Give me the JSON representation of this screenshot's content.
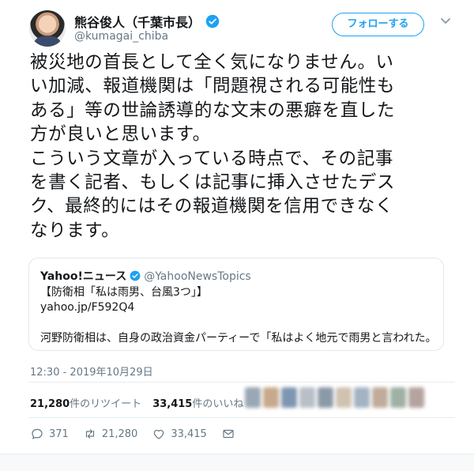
{
  "user": {
    "display_name": "熊谷俊人（千葉市長）",
    "handle": "@kumagai_chiba",
    "verified": true
  },
  "follow_button_label": "フォローする",
  "tweet": {
    "lines": [
      "被災地の首長として全く気になりません。い",
      "い加減、報道機関は「問題視される可能性も",
      "ある」等の世論誘導的な文末の悪癖を直した",
      "方が良いと思います。",
      "こういう文章が入っている時点で、その記事",
      "を書く記者、もしくは記事に挿入させたデス",
      "ク、最終的にはその報道機関を信用できなく",
      "なります。"
    ]
  },
  "quoted_tweet": {
    "source_name": "Yahoo!ニュース",
    "handle": "@YahooNewsTopics",
    "line1": "【防衛相「私は雨男、台風3つ」】",
    "line2": "yahoo.jp/F592Q4",
    "line3": "河野防衛相は、自身の政治資金パーティーで「私はよく地元で雨男と言われた。…"
  },
  "timestamp": "12:30 - 2019年10月29日",
  "stats": {
    "retweets_count": "21,280",
    "retweets_label": "件のリツイート",
    "likes_count": "33,415",
    "likes_label": "件のいいね"
  },
  "actions": {
    "reply_count": "371",
    "retweet_count": "21,280",
    "like_count": "33,415"
  },
  "colors": {
    "accent": "#1da1f2",
    "text": "#14171a",
    "muted": "#657786",
    "border": "#e1e8ed"
  }
}
